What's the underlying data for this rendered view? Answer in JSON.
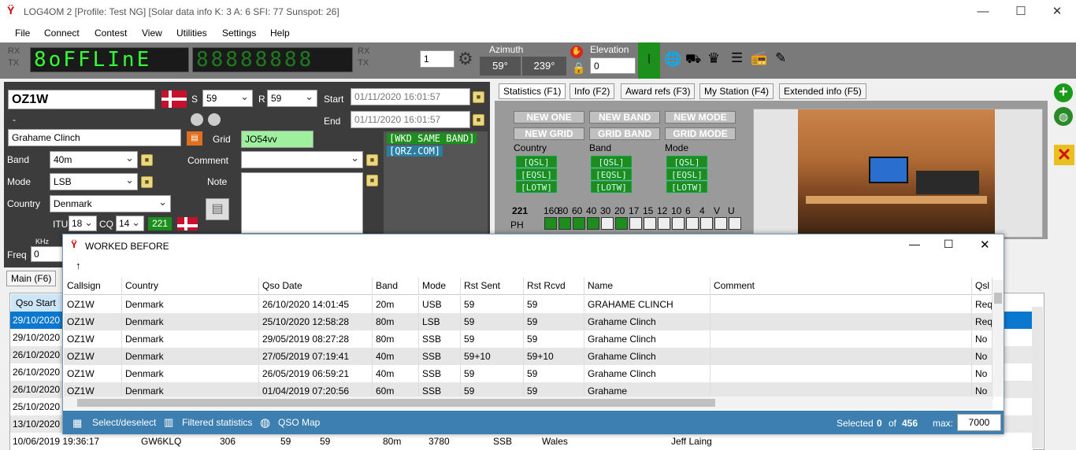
{
  "window": {
    "title": "LOG4OM 2 [Profile: Test NG] [Solar data info K: 3 A: 6 SFI: 77 Sunspot: 26]"
  },
  "menu": [
    "File",
    "Connect",
    "Contest",
    "View",
    "Utilities",
    "Settings",
    "Help"
  ],
  "toolbar": {
    "rx": "RX",
    "tx": "TX",
    "display_left": "8oFFLInE",
    "display_right": "88888888",
    "stepper": "1",
    "azimuth_label": "Azimuth",
    "az1": "59°",
    "az2": "239°",
    "elevation_label": "Elevation",
    "elevation": "0"
  },
  "qso": {
    "callsign": "OZ1W",
    "dash": "-",
    "name": "Grahame Clinch",
    "s_label": "S",
    "s_value": "59",
    "r_label": "R",
    "r_value": "59",
    "start_label": "Start",
    "start": "01/11/2020 16:01:57",
    "end_label": "End",
    "end": "01/11/2020 16:01:57",
    "grid_label": "Grid",
    "grid": "JO54vv",
    "band_label": "Band",
    "band": "40m",
    "mode_label": "Mode",
    "mode": "LSB",
    "country_label": "Country",
    "country": "Denmark",
    "itu_label": "ITU",
    "itu": "18",
    "cq_label": "CQ",
    "cq": "14",
    "dxcc": "221",
    "comment_label": "Comment",
    "note_label": "Note",
    "freq_label": "Freq",
    "freq": "0",
    "khz": "KHz",
    "info_lines": [
      "[WKD SAME BAND]",
      "[QRZ.COM]"
    ]
  },
  "tabs": [
    "Statistics (F1)",
    "Info (F2)",
    "Award refs (F3)",
    "My Station (F4)",
    "Extended info (F5)"
  ],
  "stats": {
    "new_buttons": [
      "NEW ONE",
      "NEW BAND",
      "NEW MODE",
      "NEW GRID",
      "GRID BAND",
      "GRID MODE"
    ],
    "col_labels": [
      "Country",
      "Band",
      "Mode"
    ],
    "confirm": [
      "[QSL]",
      "[EQSL]",
      "[LOTW]"
    ],
    "dxcc": "221",
    "bands": [
      "160",
      "80",
      "60",
      "40",
      "30",
      "20",
      "17",
      "15",
      "12",
      "10",
      "6",
      "4",
      "V",
      "U"
    ],
    "ph_label": "PH",
    "ph_worked": [
      true,
      true,
      true,
      true,
      false,
      true,
      false,
      false,
      false,
      false,
      false,
      false,
      false,
      false
    ]
  },
  "main_tab": "Main (F6)",
  "bg_table": {
    "header": "Qso Start",
    "rows": [
      "29/10/2020",
      "29/10/2020",
      "26/10/2020",
      "26/10/2020",
      "26/10/2020",
      "25/10/2020",
      "13/10/2020"
    ],
    "last_row": [
      "10/06/2019 19:36:17",
      "GW6KLQ",
      "306",
      "59",
      "59",
      "80m",
      "3780",
      "SSB",
      "Wales",
      "Jeff Laing"
    ]
  },
  "dialog": {
    "title": "WORKED BEFORE",
    "sort_icon": "↑",
    "columns": [
      "Callsign",
      "Country",
      "Qso Date",
      "Band",
      "Mode",
      "Rst Sent",
      "Rst Rcvd",
      "Name",
      "Comment",
      "Qsl"
    ],
    "rows": [
      [
        "OZ1W",
        "Denmark",
        "26/10/2020 14:01:45",
        "20m",
        "USB",
        "59",
        "59",
        "GRAHAME CLINCH",
        "",
        "Req"
      ],
      [
        "OZ1W",
        "Denmark",
        "25/10/2020 12:58:28",
        "80m",
        "LSB",
        "59",
        "59",
        "Grahame Clinch",
        "",
        "Req"
      ],
      [
        "OZ1W",
        "Denmark",
        "29/05/2019 08:27:28",
        "80m",
        "SSB",
        "59",
        "59",
        "Grahame Clinch",
        "",
        "No"
      ],
      [
        "OZ1W",
        "Denmark",
        "27/05/2019 07:19:41",
        "40m",
        "SSB",
        "59+10",
        "59+10",
        "Grahame Clinch",
        "",
        "No"
      ],
      [
        "OZ1W",
        "Denmark",
        "26/05/2019 06:59:21",
        "40m",
        "SSB",
        "59",
        "59",
        "Grahame Clinch",
        "",
        "No"
      ],
      [
        "OZ1W",
        "Denmark",
        "01/04/2019 07:20:56",
        "60m",
        "SSB",
        "59",
        "59",
        "Grahame",
        "",
        "No"
      ]
    ],
    "footer": {
      "select": "Select/deselect",
      "filtered": "Filtered statistics",
      "map": "QSO Map",
      "selected_label": "Selected",
      "selected": "0",
      "of_label": "of",
      "total": "456",
      "max_label": "max:",
      "max": "7000"
    }
  }
}
